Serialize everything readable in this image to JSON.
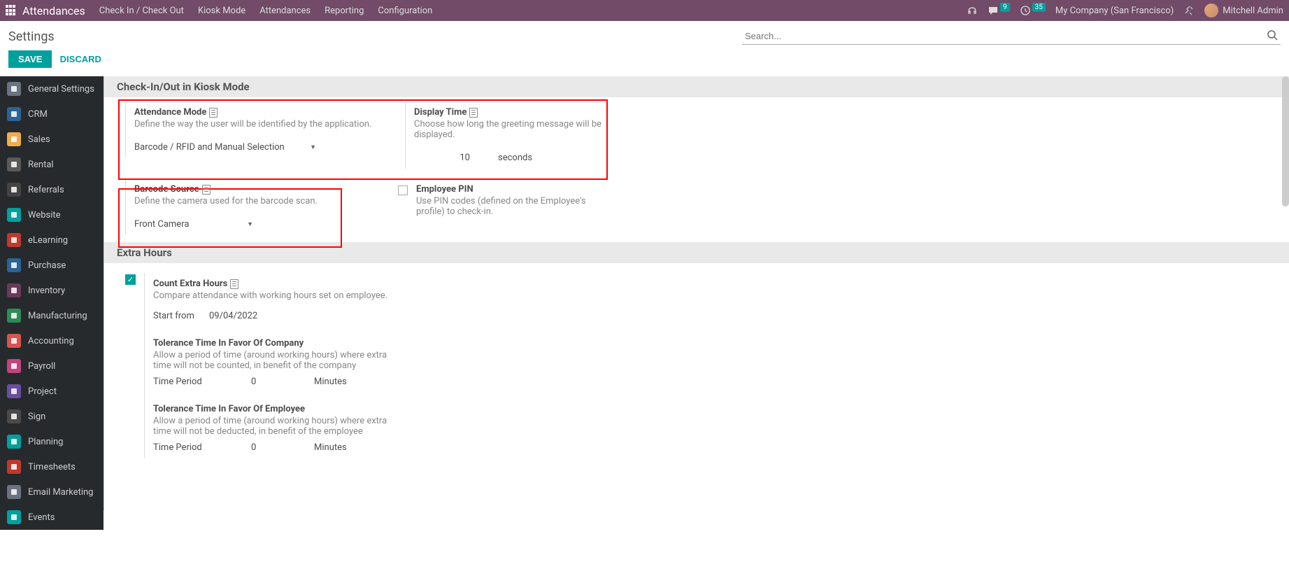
{
  "topbar": {
    "app_name": "Attendances",
    "menu": [
      "Check In / Check Out",
      "Kiosk Mode",
      "Attendances",
      "Reporting",
      "Configuration"
    ],
    "chat_badge": "9",
    "activity_badge": "35",
    "company": "My Company (San Francisco)",
    "user": "Mitchell Admin"
  },
  "header": {
    "title": "Settings",
    "search_placeholder": "Search..."
  },
  "actions": {
    "save": "SAVE",
    "discard": "DISCARD"
  },
  "sidebar": {
    "items": [
      {
        "label": "General Settings",
        "bg": "#6b7280"
      },
      {
        "label": "CRM",
        "bg": "#2a6496"
      },
      {
        "label": "Sales",
        "bg": "#f0ad4e"
      },
      {
        "label": "Rental",
        "bg": "#5a5a5a"
      },
      {
        "label": "Referrals",
        "bg": "#444"
      },
      {
        "label": "Website",
        "bg": "#00a09d"
      },
      {
        "label": "eLearning",
        "bg": "#c0392b"
      },
      {
        "label": "Purchase",
        "bg": "#2a6496"
      },
      {
        "label": "Inventory",
        "bg": "#6b3a5b"
      },
      {
        "label": "Manufacturing",
        "bg": "#2e8b57"
      },
      {
        "label": "Accounting",
        "bg": "#d9534f"
      },
      {
        "label": "Payroll",
        "bg": "#c0447f"
      },
      {
        "label": "Project",
        "bg": "#6b4e9e"
      },
      {
        "label": "Sign",
        "bg": "#4a4a4a"
      },
      {
        "label": "Planning",
        "bg": "#00a09d"
      },
      {
        "label": "Timesheets",
        "bg": "#c0392b"
      },
      {
        "label": "Email Marketing",
        "bg": "#6b7280"
      },
      {
        "label": "Events",
        "bg": "#00a09d"
      }
    ]
  },
  "sections": {
    "kiosk": {
      "header": "Check-In/Out in Kiosk Mode",
      "attendance_mode": {
        "title": "Attendance Mode",
        "desc": "Define the way the user will be identified by the application.",
        "value": "Barcode / RFID and Manual Selection"
      },
      "display_time": {
        "title": "Display Time",
        "desc": "Choose how long the greeting message will be displayed.",
        "value": "10",
        "unit": "seconds"
      },
      "barcode_source": {
        "title": "Barcode Source",
        "desc": "Define the camera used for the barcode scan.",
        "value": "Front Camera"
      },
      "employee_pin": {
        "title": "Employee PIN",
        "desc": "Use PIN codes (defined on the Employee's profile) to check-in."
      }
    },
    "extra": {
      "header": "Extra Hours",
      "count": {
        "title": "Count Extra Hours",
        "desc": "Compare attendance with working hours set on employee.",
        "start_label": "Start from",
        "start_value": "09/04/2022"
      },
      "tol_company": {
        "title": "Tolerance Time In Favor Of Company",
        "desc": "Allow a period of time (around working hours) where extra time will not be counted, in benefit of the company",
        "period_label": "Time Period",
        "value": "0",
        "unit": "Minutes"
      },
      "tol_employee": {
        "title": "Tolerance Time In Favor Of Employee",
        "desc": "Allow a period of time (around working hours) where extra time will not be deducted, in benefit of the employee",
        "period_label": "Time Period",
        "value": "0",
        "unit": "Minutes"
      }
    }
  }
}
